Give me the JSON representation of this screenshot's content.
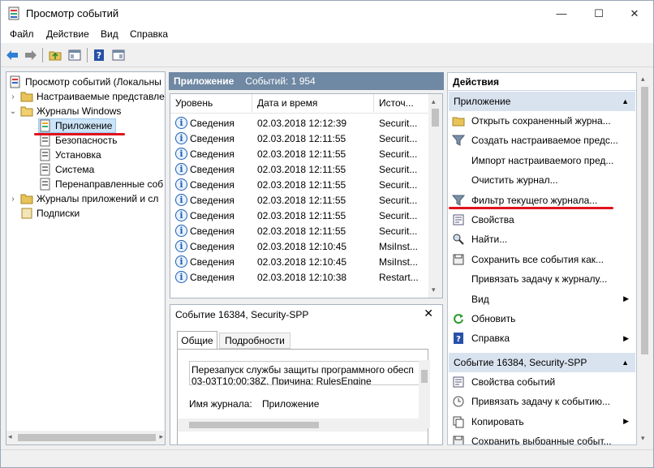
{
  "window": {
    "title": "Просмотр событий",
    "minimize": "—",
    "maximize": "☐",
    "close": "✕"
  },
  "menu": [
    "Файл",
    "Действие",
    "Вид",
    "Справка"
  ],
  "tree": {
    "root": "Просмотр событий (Локальны",
    "custom": "Настраиваемые представле",
    "windows_logs": "Журналы Windows",
    "children": [
      "Приложение",
      "Безопасность",
      "Установка",
      "Система",
      "Перенаправленные соб"
    ],
    "app_logs": "Журналы приложений и сл",
    "subscriptions": "Подписки"
  },
  "center": {
    "header_title": "Приложение",
    "header_count": "Событий: 1 954",
    "columns": [
      "Уровень",
      "Дата и время",
      "Источ..."
    ],
    "rows": [
      {
        "level": "Сведения",
        "date": "02.03.2018 12:12:39",
        "source": "Securit..."
      },
      {
        "level": "Сведения",
        "date": "02.03.2018 12:11:55",
        "source": "Securit..."
      },
      {
        "level": "Сведения",
        "date": "02.03.2018 12:11:55",
        "source": "Securit..."
      },
      {
        "level": "Сведения",
        "date": "02.03.2018 12:11:55",
        "source": "Securit..."
      },
      {
        "level": "Сведения",
        "date": "02.03.2018 12:11:55",
        "source": "Securit..."
      },
      {
        "level": "Сведения",
        "date": "02.03.2018 12:11:55",
        "source": "Securit..."
      },
      {
        "level": "Сведения",
        "date": "02.03.2018 12:11:55",
        "source": "Securit..."
      },
      {
        "level": "Сведения",
        "date": "02.03.2018 12:11:55",
        "source": "Securit..."
      },
      {
        "level": "Сведения",
        "date": "02.03.2018 12:10:45",
        "source": "MsiInst..."
      },
      {
        "level": "Сведения",
        "date": "02.03.2018 12:10:45",
        "source": "MsiInst..."
      },
      {
        "level": "Сведения",
        "date": "02.03.2018 12:10:38",
        "source": "Restart..."
      }
    ],
    "detail_title": "Событие 16384, Security-SPP",
    "tabs": [
      "Общие",
      "Подробности"
    ],
    "message_line1": "Перезапуск службы защиты программного обесп",
    "message_line2": "03-03T10:00:38Z. Причина: RulesEngine",
    "field_label": "Имя журнала:",
    "field_value": "Приложение"
  },
  "actions": {
    "header": "Действия",
    "section1": "Приложение",
    "items1": [
      {
        "label": "Открыть сохраненный журна...",
        "icon": "folder-icon"
      },
      {
        "label": "Создать настраиваемое предс...",
        "icon": "filter-icon"
      },
      {
        "label": "Импорт настраиваемого пред...",
        "icon": ""
      },
      {
        "label": "Очистить журнал...",
        "icon": ""
      },
      {
        "label": "Фильтр текущего журнала...",
        "icon": "filter-icon"
      },
      {
        "label": "Свойства",
        "icon": "properties-icon"
      },
      {
        "label": "Найти...",
        "icon": "find-icon"
      },
      {
        "label": "Сохранить все события как...",
        "icon": "save-icon"
      },
      {
        "label": "Привязать задачу к журналу...",
        "icon": ""
      },
      {
        "label": "Вид",
        "icon": "",
        "submenu": true
      },
      {
        "label": "Обновить",
        "icon": "refresh-icon"
      },
      {
        "label": "Справка",
        "icon": "help-icon",
        "submenu": true
      }
    ],
    "section2": "Событие 16384, Security-SPP",
    "items2": [
      {
        "label": "Свойства событий",
        "icon": "properties-icon"
      },
      {
        "label": "Привязать задачу к событию...",
        "icon": "task-icon"
      },
      {
        "label": "Копировать",
        "icon": "copy-icon",
        "submenu": true
      },
      {
        "label": "Сохранить выбранные событ...",
        "icon": "save-icon"
      }
    ]
  },
  "colors": {
    "accent": "#6f88a3",
    "section": "#d9e3f0",
    "underline": "#e0121c"
  }
}
